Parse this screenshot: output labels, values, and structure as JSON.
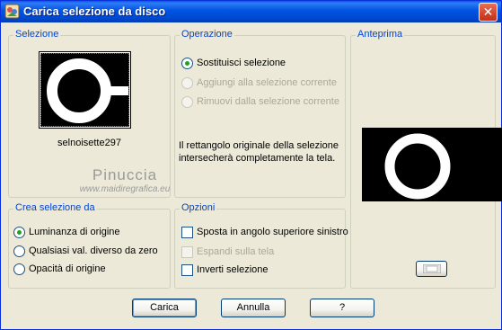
{
  "window": {
    "title": "Carica selezione da disco",
    "close_glyph": "✕"
  },
  "selezione": {
    "legend": "Selezione",
    "thumbnail_name": "selnoisette297"
  },
  "operazione": {
    "legend": "Operazione",
    "options": [
      {
        "label": "Sostituisci selezione",
        "checked": true,
        "enabled": true
      },
      {
        "label": "Aggiungi alla selezione corrente",
        "checked": false,
        "enabled": false
      },
      {
        "label": "Rimuovi dalla selezione corrente",
        "checked": false,
        "enabled": false
      }
    ],
    "description": "Il rettangolo originale della selezione intersecherà completamente la tela."
  },
  "anteprima": {
    "legend": "Anteprima"
  },
  "watermark": {
    "name": "Pinuccia",
    "url": "www.maidiregrafica.eu"
  },
  "crea": {
    "legend": "Crea selezione da",
    "options": [
      {
        "label": "Luminanza di origine",
        "checked": true
      },
      {
        "label": "Qualsiasi val. diverso da zero",
        "checked": false
      },
      {
        "label": "Opacità di origine",
        "checked": false
      }
    ]
  },
  "opzioni": {
    "legend": "Opzioni",
    "items": [
      {
        "label": "Sposta in angolo superiore sinistro",
        "checked": false,
        "enabled": true
      },
      {
        "label": "Espandi sulla tela",
        "checked": false,
        "enabled": false
      },
      {
        "label": "Inverti selezione",
        "checked": false,
        "enabled": true
      }
    ]
  },
  "buttons": {
    "load": "Carica",
    "cancel": "Annulla",
    "help": "?"
  },
  "colors": {
    "title_bar": "#0054E3",
    "legend_text": "#0046D5",
    "radio_dot": "#21A121",
    "disabled_text": "#ACA899"
  }
}
